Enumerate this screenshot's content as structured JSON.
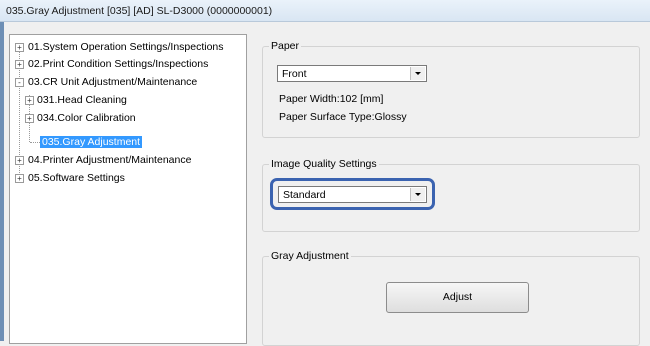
{
  "window": {
    "title": "035.Gray Adjustment  [035]  [AD]  SL-D3000  (0000000001)"
  },
  "tree": {
    "items": [
      {
        "label": "01.System Operation Settings/Inspections",
        "expander": "+"
      },
      {
        "label": "02.Print Condition Settings/Inspections",
        "expander": "+"
      },
      {
        "label": "03.CR Unit Adjustment/Maintenance",
        "expander": "-"
      },
      {
        "label": "031.Head Cleaning",
        "expander": "+"
      },
      {
        "label": "034.Color Calibration",
        "expander": "+"
      },
      {
        "label": "035.Gray Adjustment",
        "expander": ""
      },
      {
        "label": "04.Printer Adjustment/Maintenance",
        "expander": "+"
      },
      {
        "label": "05.Software Settings",
        "expander": "+"
      }
    ]
  },
  "paper": {
    "legend": "Paper",
    "side_value": "Front",
    "width_text": "Paper Width:102 [mm]",
    "surface_text": "Paper Surface Type:Glossy"
  },
  "quality": {
    "legend": "Image Quality Settings",
    "value": "Standard"
  },
  "gray": {
    "legend": "Gray Adjustment",
    "button_label": "Adjust"
  },
  "colors": {
    "selection": "#3399ff",
    "focus_ring": "#3b63b0"
  }
}
